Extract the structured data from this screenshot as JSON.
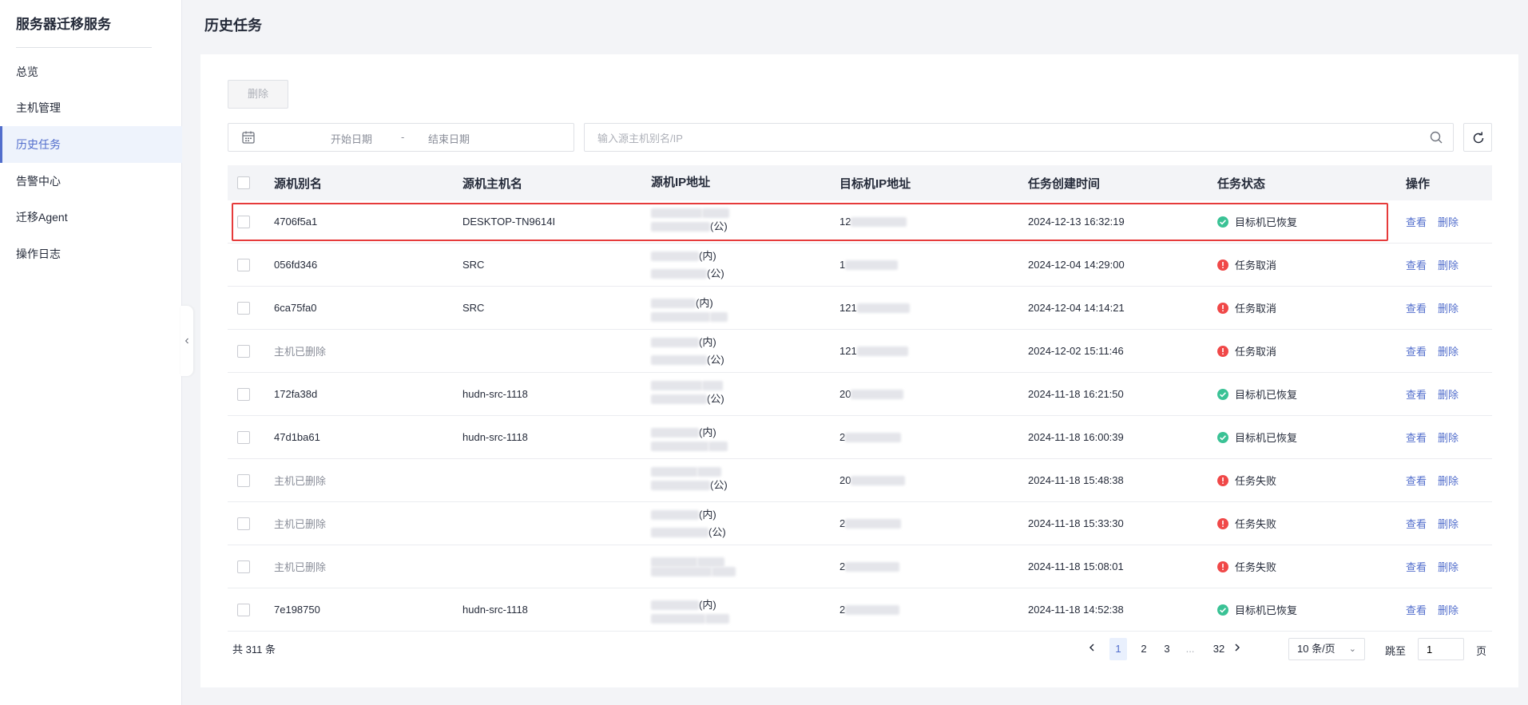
{
  "sidebar": {
    "app_title": "服务器迁移服务",
    "items": [
      {
        "label": "总览"
      },
      {
        "label": "主机管理"
      },
      {
        "label": "历史任务"
      },
      {
        "label": "告警中心"
      },
      {
        "label": "迁移Agent"
      },
      {
        "label": "操作日志"
      }
    ],
    "active_item": "历史任务"
  },
  "page": {
    "title": "历史任务"
  },
  "toolbar": {
    "delete_label": "删除",
    "date_start_placeholder": "开始日期",
    "date_separator": "-",
    "date_end_placeholder": "结束日期",
    "search_placeholder": "输入源主机别名/IP"
  },
  "table": {
    "headers": {
      "alias": "源机别名",
      "hostname": "源机主机名",
      "src_ip": "源机IP地址",
      "dst_ip": "目标机IP地址",
      "created": "任务创建时间",
      "status": "任务状态",
      "ops": "操作"
    },
    "op_view": "查看",
    "op_delete": "删除",
    "rows": [
      {
        "alias": "4706f5a1",
        "hostname": "DESKTOP-TN9614I",
        "src_ip_1": "",
        "src_ip_2": "(公)",
        "dst_ip": "12",
        "created": "2024-12-13 16:32:19",
        "status": "目标机已恢复",
        "status_type": "success",
        "highlighted": true
      },
      {
        "alias": "056fd346",
        "hostname": "SRC",
        "src_ip_1": "(内)",
        "src_ip_2": "(公)",
        "dst_ip": "1",
        "created": "2024-12-04 14:29:00",
        "status": "任务取消",
        "status_type": "error",
        "highlighted": false
      },
      {
        "alias": "6ca75fa0",
        "hostname": "SRC",
        "src_ip_1": "(内)",
        "src_ip_2": "",
        "dst_ip": "121",
        "created": "2024-12-04 14:14:21",
        "status": "任务取消",
        "status_type": "error",
        "highlighted": false
      },
      {
        "alias": "主机已删除",
        "hostname": "",
        "src_ip_1": "(内)",
        "src_ip_2": "(公)",
        "dst_ip": "121",
        "created": "2024-12-02 15:11:46",
        "status": "任务取消",
        "status_type": "error",
        "highlighted": false
      },
      {
        "alias": "172fa38d",
        "hostname": "hudn-src-1118",
        "src_ip_1": "",
        "src_ip_2": "(公)",
        "dst_ip": "20",
        "created": "2024-11-18 16:21:50",
        "status": "目标机已恢复",
        "status_type": "success",
        "highlighted": false
      },
      {
        "alias": "47d1ba61",
        "hostname": "hudn-src-1118",
        "src_ip_1": "(内)",
        "src_ip_2": "",
        "dst_ip": "2",
        "created": "2024-11-18 16:00:39",
        "status": "目标机已恢复",
        "status_type": "success",
        "highlighted": false
      },
      {
        "alias": "主机已删除",
        "hostname": "",
        "src_ip_1": "",
        "src_ip_2": "(公)",
        "dst_ip": "20",
        "created": "2024-11-18 15:48:38",
        "status": "任务失败",
        "status_type": "error",
        "highlighted": false
      },
      {
        "alias": "主机已删除",
        "hostname": "",
        "src_ip_1": "(内)",
        "src_ip_2": "(公)",
        "dst_ip": "2",
        "created": "2024-11-18 15:33:30",
        "status": "任务失败",
        "status_type": "error",
        "highlighted": false
      },
      {
        "alias": "主机已删除",
        "hostname": "",
        "src_ip_1": "",
        "src_ip_2": "",
        "dst_ip": "2",
        "created": "2024-11-18 15:08:01",
        "status": "任务失败",
        "status_type": "error",
        "highlighted": false
      },
      {
        "alias": "7e198750",
        "hostname": "hudn-src-1118",
        "src_ip_1": "(内)",
        "src_ip_2": "",
        "dst_ip": "2",
        "created": "2024-11-18 14:52:38",
        "status": "目标机已恢复",
        "status_type": "success",
        "highlighted": false
      }
    ]
  },
  "pagination": {
    "total_label": "共 311 条",
    "pages": [
      "1",
      "2",
      "3",
      "...",
      "32"
    ],
    "current_page": "1",
    "page_size_label": "10 条/页",
    "jump_label": "跳至",
    "jump_value": "1",
    "page_unit": "页"
  },
  "colors": {
    "accent": "#526ecc",
    "success": "#3ac295",
    "error": "#f04848",
    "highlight_border": "#e63b3b"
  }
}
